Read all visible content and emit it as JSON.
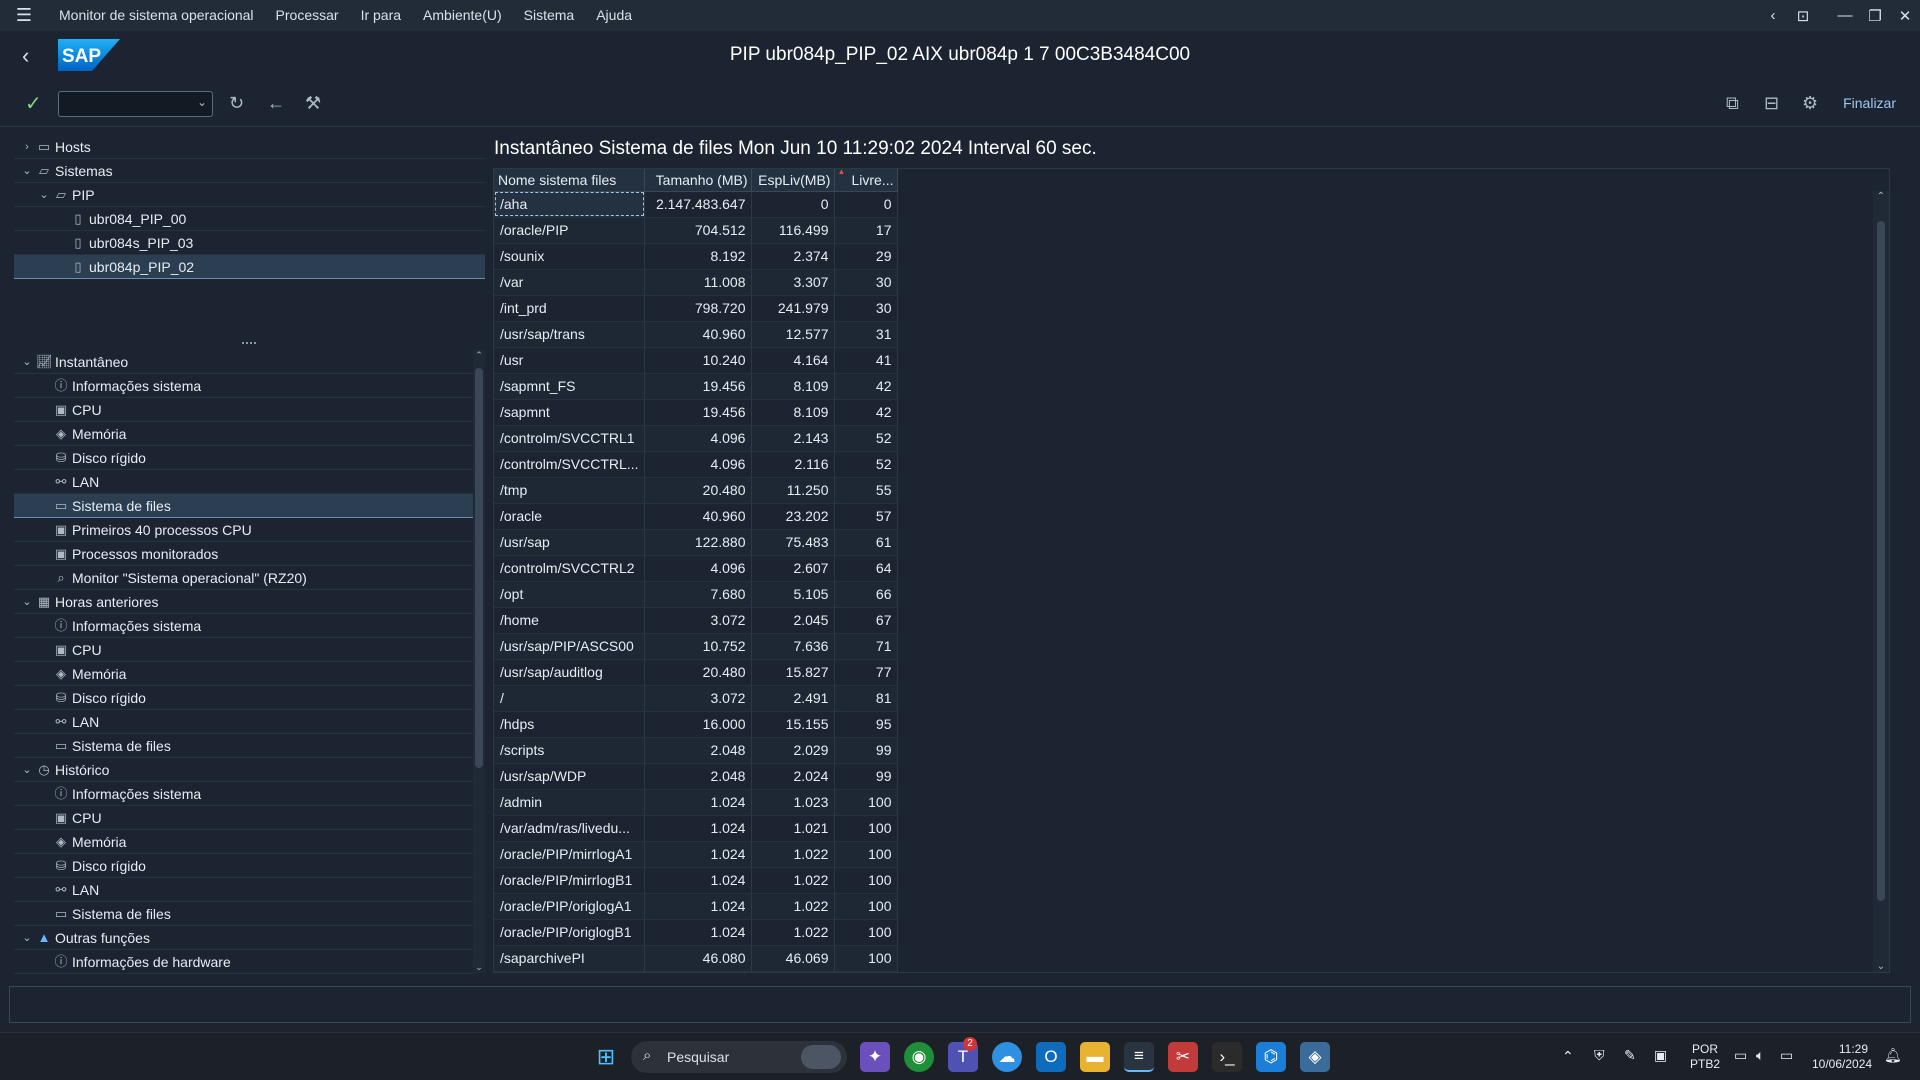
{
  "menubar": {
    "items": [
      "Monitor de sistema operacional",
      "Processar",
      "Ir para",
      "Ambiente(U)",
      "Sistema",
      "Ajuda"
    ]
  },
  "titlebar": {
    "title": "PIP ubr084p_PIP_02 AIX ubr084p 1 7 00C3B3484C00"
  },
  "toolbar": {
    "command_value": "",
    "finalizar_label": "Finalizar"
  },
  "tree_top": [
    {
      "label": "Hosts",
      "level": 0,
      "expander": "collapsed",
      "icon": "folder-icon"
    },
    {
      "label": "Sistemas",
      "level": 0,
      "expander": "expanded",
      "icon": "folder-open-icon"
    },
    {
      "label": "PIP",
      "level": 1,
      "expander": "expanded",
      "icon": "folder-open-icon"
    },
    {
      "label": "ubr084_PIP_00",
      "level": 2,
      "expander": "none",
      "icon": "server-icon"
    },
    {
      "label": "ubr084s_PIP_03",
      "level": 2,
      "expander": "none",
      "icon": "server-icon"
    },
    {
      "label": "ubr084p_PIP_02",
      "level": 2,
      "expander": "none",
      "icon": "server-icon",
      "selected": true
    }
  ],
  "tree_bottom": [
    {
      "label": "Instantâneo",
      "level": 0,
      "expander": "expanded",
      "icon": "chart-icon"
    },
    {
      "label": "Informações sistema",
      "level": 1,
      "icon": "info-icon"
    },
    {
      "label": "CPU",
      "level": 1,
      "icon": "cpu-icon"
    },
    {
      "label": "Memória",
      "level": 1,
      "icon": "memory-icon"
    },
    {
      "label": "Disco rígido",
      "level": 1,
      "icon": "disk-icon"
    },
    {
      "label": "LAN",
      "level": 1,
      "icon": "network-icon"
    },
    {
      "label": "Sistema de files",
      "level": 1,
      "icon": "folder-icon",
      "selected": true
    },
    {
      "label": "Primeiros 40 processos CPU",
      "level": 1,
      "icon": "cpu-icon"
    },
    {
      "label": "Processos monitorados",
      "level": 1,
      "icon": "cpu-icon"
    },
    {
      "label": "Monitor \"Sistema operacional\" (RZ20)",
      "level": 1,
      "icon": "search-icon"
    },
    {
      "label": "Horas anteriores",
      "level": 0,
      "expander": "expanded",
      "icon": "calendar-icon"
    },
    {
      "label": "Informações sistema",
      "level": 1,
      "icon": "info-icon"
    },
    {
      "label": "CPU",
      "level": 1,
      "icon": "cpu-icon"
    },
    {
      "label": "Memória",
      "level": 1,
      "icon": "memory-icon"
    },
    {
      "label": "Disco rígido",
      "level": 1,
      "icon": "disk-icon"
    },
    {
      "label": "LAN",
      "level": 1,
      "icon": "network-icon"
    },
    {
      "label": "Sistema de files",
      "level": 1,
      "icon": "folder-icon"
    },
    {
      "label": "Histórico",
      "level": 0,
      "expander": "expanded",
      "icon": "history-icon"
    },
    {
      "label": "Informações sistema",
      "level": 1,
      "icon": "info-icon"
    },
    {
      "label": "CPU",
      "level": 1,
      "icon": "cpu-icon"
    },
    {
      "label": "Memória",
      "level": 1,
      "icon": "memory-icon"
    },
    {
      "label": "Disco rígido",
      "level": 1,
      "icon": "disk-icon"
    },
    {
      "label": "LAN",
      "level": 1,
      "icon": "network-icon"
    },
    {
      "label": "Sistema de files",
      "level": 1,
      "icon": "folder-icon"
    },
    {
      "label": "Outras funções",
      "level": 0,
      "expander": "expanded",
      "icon": "triangle-icon"
    },
    {
      "label": "Informações de hardware",
      "level": 1,
      "icon": "info-icon"
    }
  ],
  "content": {
    "title": "Instantâneo Sistema de files Mon Jun 10 11:29:02 2024 Interval 60 sec."
  },
  "grid": {
    "headers": [
      "Nome sistema files",
      "Tamanho (MB)",
      "EspLiv(MB)",
      "Livre..."
    ],
    "rows": [
      [
        "/aha",
        "2.147.483.647",
        "0",
        "0"
      ],
      [
        "/oracle/PIP",
        "704.512",
        "116.499",
        "17"
      ],
      [
        "/sounix",
        "8.192",
        "2.374",
        "29"
      ],
      [
        "/var",
        "11.008",
        "3.307",
        "30"
      ],
      [
        "/int_prd",
        "798.720",
        "241.979",
        "30"
      ],
      [
        "/usr/sap/trans",
        "40.960",
        "12.577",
        "31"
      ],
      [
        "/usr",
        "10.240",
        "4.164",
        "41"
      ],
      [
        "/sapmnt_FS",
        "19.456",
        "8.109",
        "42"
      ],
      [
        "/sapmnt",
        "19.456",
        "8.109",
        "42"
      ],
      [
        "/controlm/SVCCTRL1",
        "4.096",
        "2.143",
        "52"
      ],
      [
        "/controlm/SVCCTRL...",
        "4.096",
        "2.116",
        "52"
      ],
      [
        "/tmp",
        "20.480",
        "11.250",
        "55"
      ],
      [
        "/oracle",
        "40.960",
        "23.202",
        "57"
      ],
      [
        "/usr/sap",
        "122.880",
        "75.483",
        "61"
      ],
      [
        "/controlm/SVCCTRL2",
        "4.096",
        "2.607",
        "64"
      ],
      [
        "/opt",
        "7.680",
        "5.105",
        "66"
      ],
      [
        "/home",
        "3.072",
        "2.045",
        "67"
      ],
      [
        "/usr/sap/PIP/ASCS00",
        "10.752",
        "7.636",
        "71"
      ],
      [
        "/usr/sap/auditlog",
        "20.480",
        "15.827",
        "77"
      ],
      [
        "/",
        "3.072",
        "2.491",
        "81"
      ],
      [
        "/hdps",
        "16.000",
        "15.155",
        "95"
      ],
      [
        "/scripts",
        "2.048",
        "2.029",
        "99"
      ],
      [
        "/usr/sap/WDP",
        "2.048",
        "2.024",
        "99"
      ],
      [
        "/admin",
        "1.024",
        "1.023",
        "100"
      ],
      [
        "/var/adm/ras/livedu...",
        "1.024",
        "1.021",
        "100"
      ],
      [
        "/oracle/PIP/mirrlogA1",
        "1.024",
        "1.022",
        "100"
      ],
      [
        "/oracle/PIP/mirrlogB1",
        "1.024",
        "1.022",
        "100"
      ],
      [
        "/oracle/PIP/origlogA1",
        "1.024",
        "1.022",
        "100"
      ],
      [
        "/oracle/PIP/origlogB1",
        "1.024",
        "1.022",
        "100"
      ],
      [
        "/saparchivePI",
        "46.080",
        "46.069",
        "100"
      ]
    ]
  },
  "taskbar": {
    "search_placeholder": "Pesquisar",
    "teams_badge": "2",
    "lang_top": "POR",
    "lang_bottom": "PTB2",
    "time": "11:29",
    "date": "10/06/2024"
  }
}
